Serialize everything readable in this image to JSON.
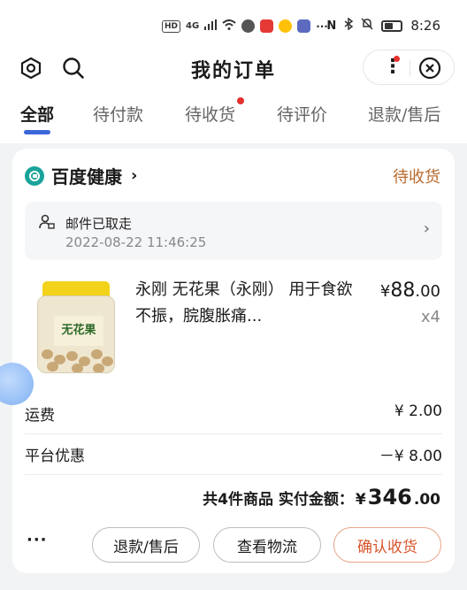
{
  "status_bar": {
    "left_chips": [
      "HD",
      "4G"
    ],
    "time": "8:26"
  },
  "header": {
    "title": "我的订单"
  },
  "tabs": [
    {
      "label": "全部",
      "active": true
    },
    {
      "label": "待付款"
    },
    {
      "label": "待收货",
      "has_dot": true
    },
    {
      "label": "待评价"
    },
    {
      "label": "退款/售后"
    }
  ],
  "order": {
    "store_name": "百度健康",
    "status": "待收货",
    "logistics": {
      "status": "邮件已取走",
      "time": "2022-08-22 11:46:25"
    },
    "product": {
      "name": "永刚 无花果（永刚） 用于食欲不振，脘腹胀痛...",
      "image_label": "无花果",
      "price_symbol": "¥",
      "price_int": "88",
      "price_dec": ".00",
      "qty": "x4"
    },
    "shipping_label": "运费",
    "shipping_value": "¥ 2.00",
    "discount_label": "平台优惠",
    "discount_value": "－¥ 8.00",
    "total_prefix": "共4件商品 实付金额：",
    "total_symbol": "¥",
    "total_int": "346",
    "total_dec": ".00",
    "more_label": "···",
    "buttons": {
      "refund": "退款/售后",
      "logistics": "查看物流",
      "confirm": "确认收货"
    }
  },
  "colors": {
    "accent": "#3a66d8",
    "status": "#b96a2c",
    "primary_button": "#d8552c",
    "badge": "#e5302c"
  }
}
